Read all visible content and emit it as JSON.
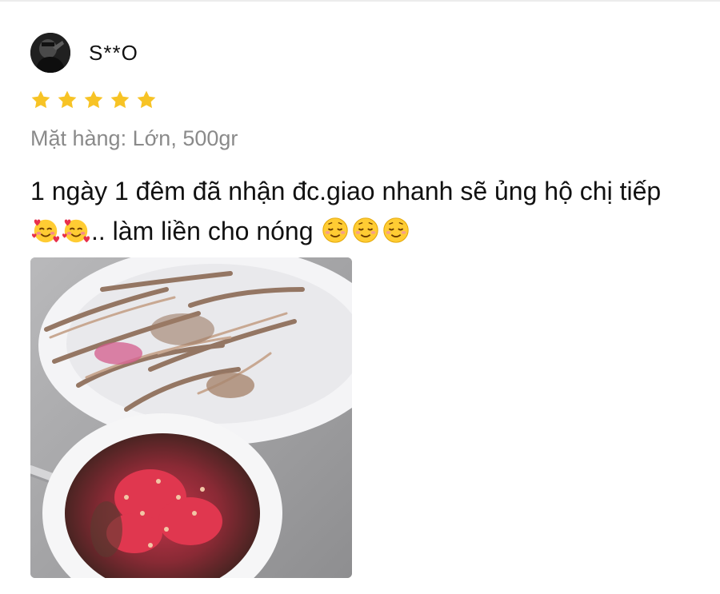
{
  "review": {
    "username": "S**O",
    "rating": 5,
    "variant_text": "Mặt hàng: Lớn, 500gr",
    "comment_part1": "1 ngày 1 đêm đã nhận đc.giao nhanh sẽ ủng hộ chị tiếp ",
    "comment_part2": ".. làm liền cho nóng ",
    "emoji_group1": [
      "smiling-face-with-hearts-icon",
      "smiling-face-with-hearts-icon"
    ],
    "emoji_group2": [
      "relieved-smiling-face-icon",
      "relieved-smiling-face-icon",
      "relieved-smiling-face-icon"
    ]
  },
  "colors": {
    "star": "#F7C325",
    "variant_text": "#8A8A8A",
    "emoji_face": "#FFCC33"
  }
}
